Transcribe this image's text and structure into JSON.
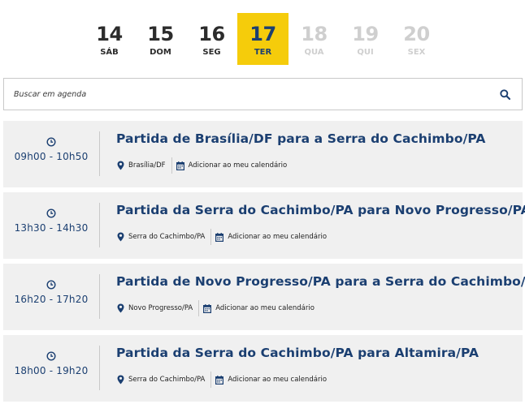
{
  "days": [
    {
      "num": "14",
      "weekday": "SÁB",
      "state": "past"
    },
    {
      "num": "15",
      "weekday": "DOM",
      "state": "past"
    },
    {
      "num": "16",
      "weekday": "SEG",
      "state": "past"
    },
    {
      "num": "17",
      "weekday": "TER",
      "state": "active"
    },
    {
      "num": "18",
      "weekday": "QUA",
      "state": "future"
    },
    {
      "num": "19",
      "weekday": "QUI",
      "state": "future"
    },
    {
      "num": "20",
      "weekday": "SEX",
      "state": "future"
    }
  ],
  "search": {
    "placeholder": "Buscar em agenda",
    "value": ""
  },
  "events": [
    {
      "time": "09h00 - 10h50",
      "title": "Partida de Brasília/DF para a Serra do Cachimbo/PA",
      "location": "Brasília/DF",
      "calendar_label": "Adicionar ao meu calendário"
    },
    {
      "time": "13h30 - 14h30",
      "title": "Partida da Serra do Cachimbo/PA para Novo Progresso/PA",
      "location": "Serra do Cachimbo/PA",
      "calendar_label": "Adicionar ao meu calendário"
    },
    {
      "time": "16h20 - 17h20",
      "title": "Partida de Novo Progresso/PA para a Serra do Cachimbo/PA",
      "location": "Novo Progresso/PA",
      "calendar_label": "Adicionar ao meu calendário"
    },
    {
      "time": "18h00 - 19h20",
      "title": "Partida da Serra do Cachimbo/PA para Altamira/PA",
      "location": "Serra do Cachimbo/PA",
      "calendar_label": "Adicionar ao meu calendário"
    }
  ],
  "icons": {
    "clock": "clock-icon",
    "location": "map-pin-icon",
    "calendar": "calendar-icon",
    "search": "search-icon"
  },
  "colors": {
    "accent": "#f5cc0b",
    "primary": "#1b3f71",
    "card_bg": "#f0f0f0",
    "inactive": "#cfcfcf"
  }
}
